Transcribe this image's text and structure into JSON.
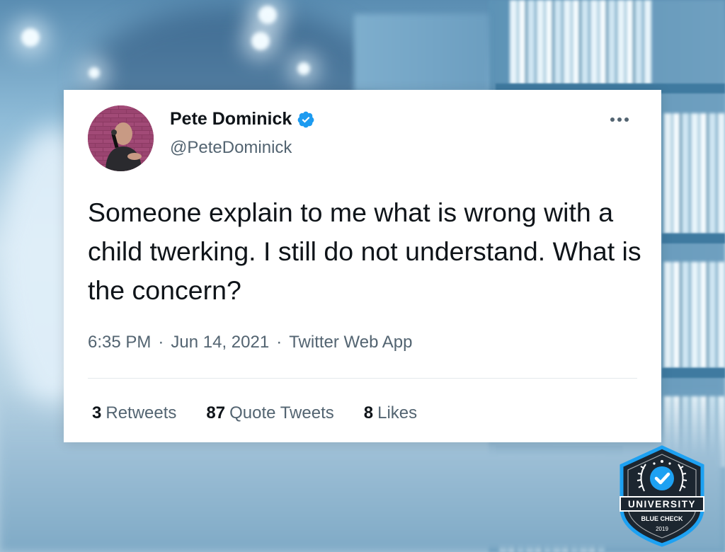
{
  "tweet": {
    "display_name": "Pete Dominick",
    "handle": "@PeteDominick",
    "text": "Someone explain to me what is wrong with a child twerking. I still do not understand. What is the concern?",
    "time": "6:35 PM",
    "date": "Jun 14, 2021",
    "source": "Twitter Web App",
    "separator": "·",
    "stats": {
      "retweets_count": "3",
      "retweets_label": "Retweets",
      "quotes_count": "87",
      "quotes_label": "Quote Tweets",
      "likes_count": "8",
      "likes_label": "Likes"
    },
    "verified_icon": "verified-check-icon",
    "more_icon": "more-options-icon"
  },
  "badge": {
    "title": "UNIVERSITY",
    "subtitle": "BLUE CHECK",
    "year": "2019"
  },
  "colors": {
    "verified_blue": "#1d9bf0",
    "text_primary": "#0f1419",
    "text_secondary": "#536471",
    "badge_dark": "#1c2630",
    "badge_blue": "#1da1f2"
  }
}
